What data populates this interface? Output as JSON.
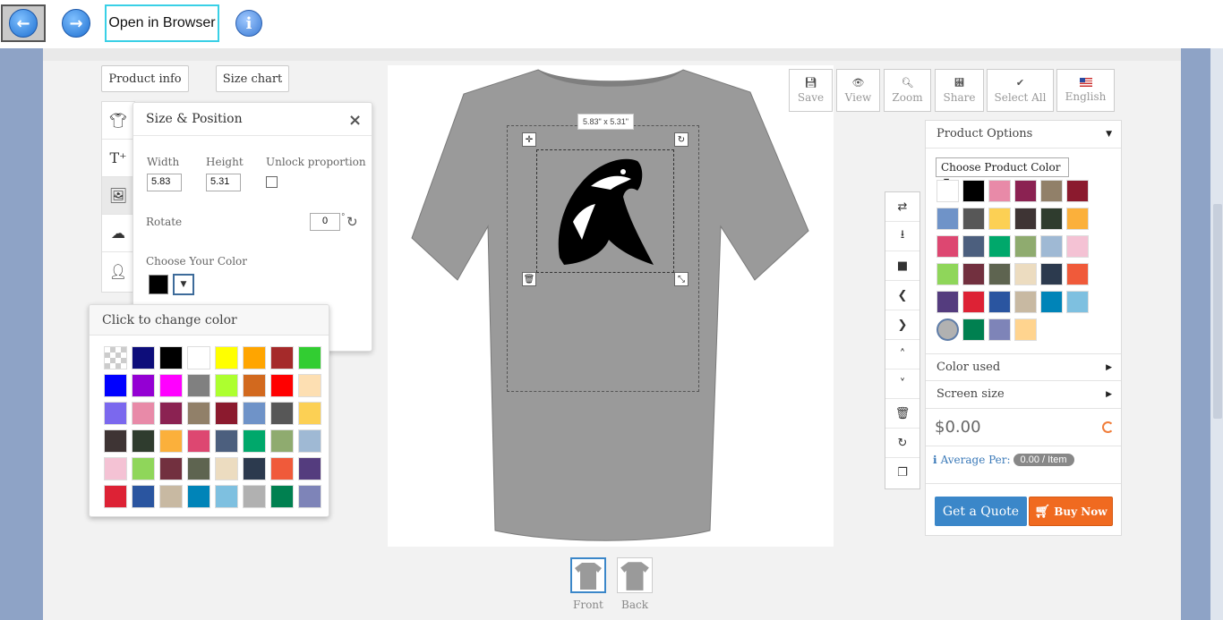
{
  "nav": {
    "open_in_browser": "Open in Browser"
  },
  "header_buttons": {
    "product_info": "Product info",
    "size_chart": "Size chart"
  },
  "size_position": {
    "title": "Size & Position",
    "close": "×",
    "width_label": "Width",
    "height_label": "Height",
    "unlock_label": "Unlock proportion",
    "width_value": "5.83",
    "height_value": "5.31",
    "rotate_label": "Rotate",
    "rotate_value": "0",
    "rotate_unit": "°",
    "choose_color_label": "Choose Your Color",
    "selected_color": "#000000"
  },
  "color_picker": {
    "title": "Click to change color",
    "colors": [
      "transparent",
      "#0d0d7a",
      "#000000",
      "#ffffff",
      "#ffff00",
      "#ffa500",
      "#a52a2a",
      "#32cd32",
      "#0000ff",
      "#9400d3",
      "#ff00ff",
      "#808080",
      "#adff2f",
      "#d2691e",
      "#ff0000",
      "#fddfb2",
      "#7b68ee",
      "#e88aa8",
      "#8b2252",
      "#918069",
      "#8b1a2e",
      "#6f93c8",
      "#575757",
      "#fcd054",
      "#3e3434",
      "#2f3c2e",
      "#fbb03b",
      "#dd4771",
      "#4c5f7e",
      "#00a86b",
      "#8fab6f",
      "#9fb9d4",
      "#f4c2d4",
      "#8fd65a",
      "#72303f",
      "#5e6450",
      "#ecdcc0",
      "#2c3a4e",
      "#f05a3a",
      "#543c7e",
      "#dd2235",
      "#2a55a0",
      "#c8b9a2",
      "#0084b8",
      "#7ec0e0",
      "#b1b1b1",
      "#008050",
      "#7e84b8"
    ]
  },
  "design": {
    "dimensions_label": "5.83\" x 5.31\""
  },
  "thumbnails": {
    "front_label": "Front",
    "back_label": "Back"
  },
  "toolbar": {
    "save": "Save",
    "view": "View",
    "zoom": "Zoom",
    "share": "Share",
    "select_all": "Select All",
    "english": "English"
  },
  "product_options": {
    "title": "Product Options",
    "choose_product_color": "Choose Product Color",
    "colors": [
      "#ffffff",
      "#000000",
      "#e88aa8",
      "#8b2252",
      "#918069",
      "#8b1a2e",
      "#6f93c8",
      "#575757",
      "#fcd054",
      "#3e3434",
      "#2f3c2e",
      "#fbb03b",
      "#dd4771",
      "#4c5f7e",
      "#00a86b",
      "#8fab6f",
      "#9fb9d4",
      "#f4c2d4",
      "#8fd65a",
      "#72303f",
      "#5e6450",
      "#ecdcc0",
      "#2c3a4e",
      "#f05a3a",
      "#543c7e",
      "#dd2235",
      "#2a55a0",
      "#c8b9a2",
      "#0084b8",
      "#7ec0e0",
      "#b1b1b1",
      "#008050",
      "#7e84b8",
      "#ffd48f"
    ],
    "selected_index": 30,
    "color_used": "Color used",
    "screen_size": "Screen size",
    "price": "$0.00",
    "average_per_label": "Average Per:",
    "average_per_value": "0.00 / Item",
    "get_quote": "Get a Quote",
    "buy_now": "Buy Now"
  }
}
